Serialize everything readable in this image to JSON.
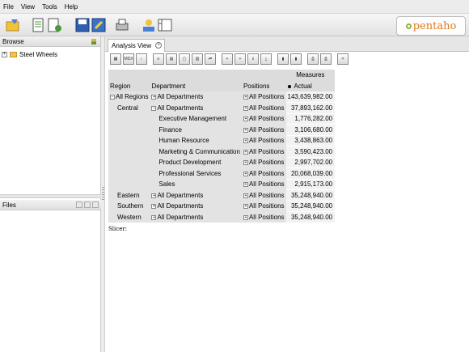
{
  "menu": [
    "File",
    "View",
    "Tools",
    "Help"
  ],
  "logo": {
    "text": "pentaho"
  },
  "browse": {
    "title": "Browse",
    "tree": [
      {
        "label": "Steel Wheels"
      }
    ]
  },
  "files": {
    "title": "Files"
  },
  "tab": {
    "label": "Analysis View"
  },
  "analysis_toolbar": {
    "mdx_label": "MDX"
  },
  "grid": {
    "measures_header": "Measures",
    "col_region": "Region",
    "col_department": "Department",
    "col_positions": "Positions",
    "col_actual": "Actual",
    "rows": [
      {
        "region": "All Regions",
        "department": "All Departments",
        "positions": "All Positions",
        "value": "143,639,982.00"
      },
      {
        "region": "Central",
        "department": "All Departments",
        "positions": "All Positions",
        "value": "37,893,162.00"
      },
      {
        "region": "",
        "department": "Executive Management",
        "positions": "All Positions",
        "value": "1,776,282.00"
      },
      {
        "region": "",
        "department": "Finance",
        "positions": "All Positions",
        "value": "3,106,680.00"
      },
      {
        "region": "",
        "department": "Human Resource",
        "positions": "All Positions",
        "value": "3,438,863.00"
      },
      {
        "region": "",
        "department": "Marketing & Communication",
        "positions": "All Positions",
        "value": "3,590,423.00"
      },
      {
        "region": "",
        "department": "Product Development",
        "positions": "All Positions",
        "value": "2,997,702.00"
      },
      {
        "region": "",
        "department": "Professional Services",
        "positions": "All Positions",
        "value": "20,068,039.00"
      },
      {
        "region": "",
        "department": "Sales",
        "positions": "All Positions",
        "value": "2,915,173.00"
      },
      {
        "region": "Eastern",
        "department": "All Departments",
        "positions": "All Positions",
        "value": "35,248,940.00"
      },
      {
        "region": "Southern",
        "department": "All Departments",
        "positions": "All Positions",
        "value": "35,248,940.00"
      },
      {
        "region": "Western",
        "department": "All Departments",
        "positions": "All Positions",
        "value": "35,248,940.00"
      }
    ]
  },
  "slicer": "Slicer:"
}
